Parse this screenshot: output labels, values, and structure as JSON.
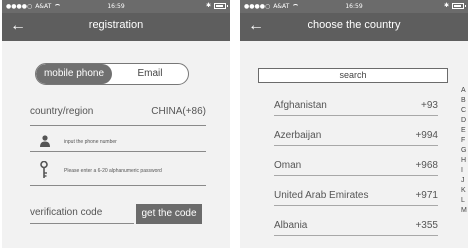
{
  "left_screen": {
    "status_bar": {
      "carrier": "A&AT",
      "time": "16:59"
    },
    "nav": {
      "title": "registration"
    },
    "tabs": [
      {
        "label": "mobile phone",
        "selected": true
      },
      {
        "label": "Email",
        "selected": false
      }
    ],
    "country": {
      "label": "country/region",
      "value": "CHINA(+86)"
    },
    "phone_field": {
      "placeholder": "input the phone number",
      "icon": "person-icon"
    },
    "password_field": {
      "placeholder": "Please enter a 6-20 alphanumeric password",
      "icon": "key-icon"
    },
    "verification": {
      "label": "verification code",
      "button_label": "get the code"
    }
  },
  "right_screen": {
    "status_bar": {
      "carrier": "A&AT",
      "time": "16:59"
    },
    "nav": {
      "title": "choose the country"
    },
    "search": {
      "label": "search"
    },
    "countries": [
      {
        "name": "Afghanistan",
        "code": "+93"
      },
      {
        "name": "Azerbaijan",
        "code": "+994"
      },
      {
        "name": "Oman",
        "code": "+968"
      },
      {
        "name": "United Arab Emirates",
        "code": "+971"
      },
      {
        "name": "Albania",
        "code": "+355"
      }
    ],
    "alphabet_index": [
      "A",
      "B",
      "C",
      "D",
      "E",
      "F",
      "G",
      "H",
      "I",
      "J",
      "K",
      "L",
      "M"
    ]
  },
  "colors": {
    "nav_bar": "#5e5e5e",
    "status_bar": "#6b6b6b",
    "button": "#6b6b6b",
    "background": "#f2f2f2"
  }
}
